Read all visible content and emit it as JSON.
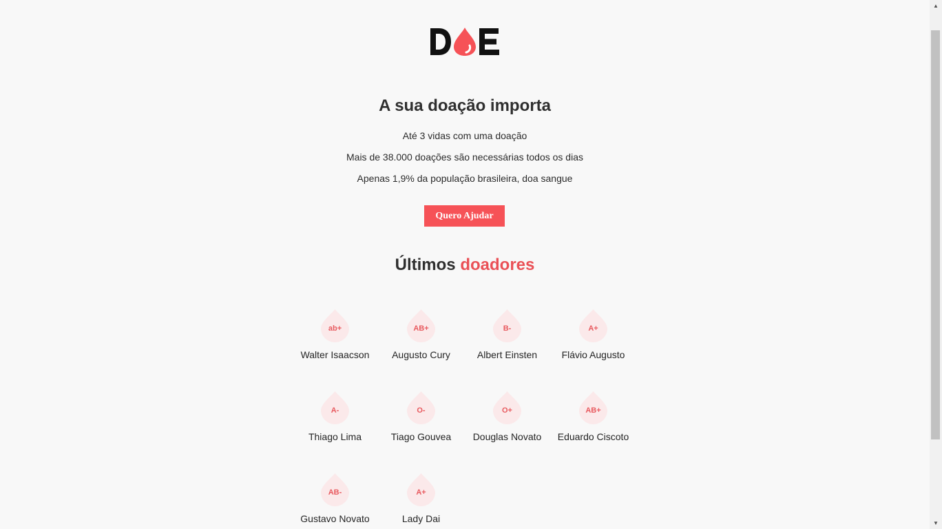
{
  "brand": {
    "logo_text": "DOE",
    "accent": "#f65257",
    "dark": "#111111"
  },
  "hero": {
    "title": "A sua doação importa",
    "facts": [
      "Até 3 vidas com uma doação",
      "Mais de 38.000 doações são necessárias todos os dias",
      "Apenas 1,9% da população brasileira, doa sangue"
    ],
    "cta_label": "Quero Ajudar"
  },
  "donors": {
    "title_main": "Últimos",
    "title_accent": "doadores",
    "list": [
      {
        "blood": "ab+",
        "name": "Walter Isaacson"
      },
      {
        "blood": "AB+",
        "name": "Augusto Cury"
      },
      {
        "blood": "B-",
        "name": "Albert Einsten"
      },
      {
        "blood": "A+",
        "name": "Flávio Augusto"
      },
      {
        "blood": "A-",
        "name": "Thiago Lima"
      },
      {
        "blood": "O-",
        "name": "Tiago Gouvea"
      },
      {
        "blood": "O+",
        "name": "Douglas Novato"
      },
      {
        "blood": "AB+",
        "name": "Eduardo Ciscoto"
      },
      {
        "blood": "AB-",
        "name": "Gustavo Novato"
      },
      {
        "blood": "A+",
        "name": "Lady Dai"
      }
    ]
  },
  "scrollbar": {
    "up_icon": "arrow-up-icon",
    "down_icon": "arrow-down-icon"
  }
}
